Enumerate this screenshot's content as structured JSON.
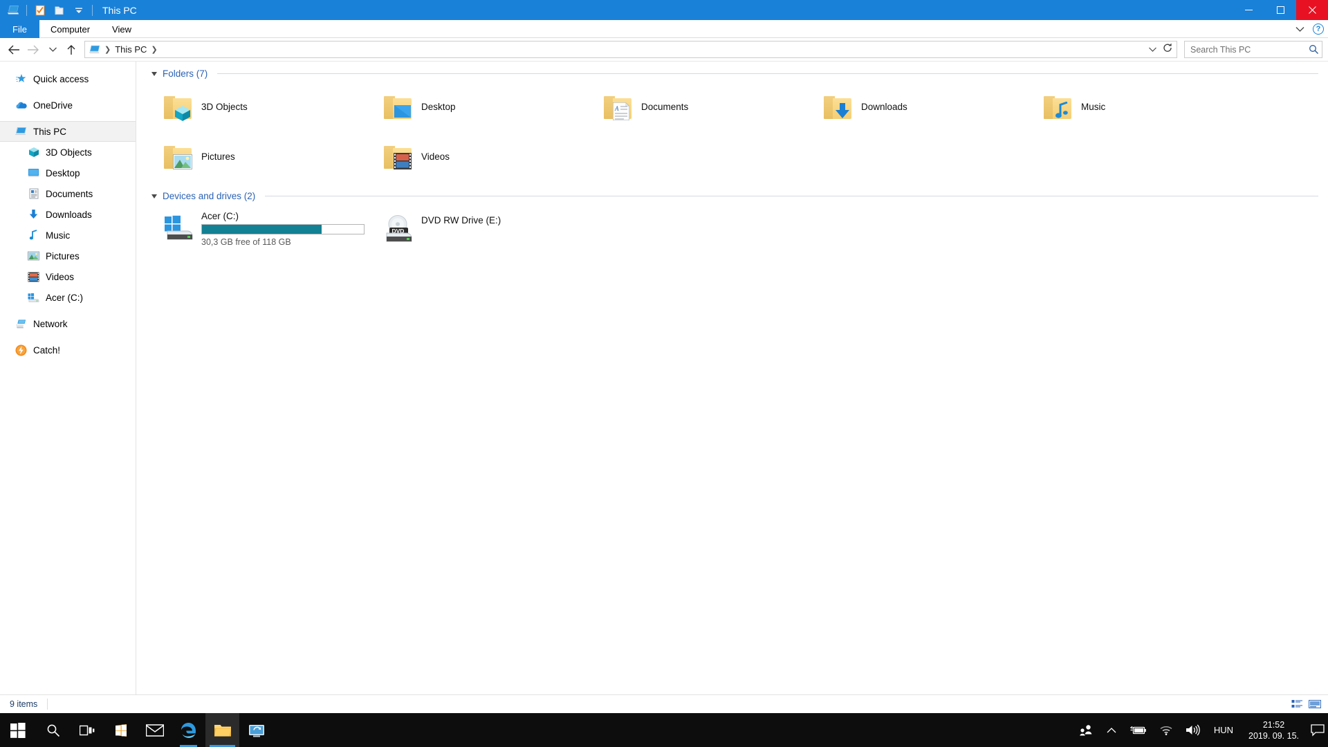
{
  "window": {
    "title": "This PC",
    "quick_access_icons": [
      "this-pc-icon",
      "properties-icon",
      "new-folder-icon",
      "customize-dropdown-icon"
    ],
    "controls": {
      "minimize": "minimize",
      "maximize": "maximize",
      "close": "close"
    }
  },
  "ribbon": {
    "tabs": [
      {
        "label": "File",
        "active_file": true
      },
      {
        "label": "Computer",
        "active_file": false
      },
      {
        "label": "View",
        "active_file": false
      }
    ],
    "collapse_label": "expand-ribbon-icon",
    "help_label": "?"
  },
  "address": {
    "back": "back-arrow-icon",
    "forward": "forward-arrow-icon",
    "recent": "recent-locations-icon",
    "up": "up-arrow-icon",
    "breadcrumb": [
      "This PC"
    ],
    "dropdown": "address-dropdown-icon",
    "refresh": "refresh-icon"
  },
  "search": {
    "placeholder": "Search This PC",
    "value": "",
    "icon": "search-icon"
  },
  "sidebar": {
    "items": [
      {
        "label": "Quick access",
        "icon": "star-icon",
        "indent": false,
        "selected": false,
        "gap_after": true
      },
      {
        "label": "OneDrive",
        "icon": "cloud-icon",
        "indent": false,
        "selected": false,
        "gap_after": true
      },
      {
        "label": "This PC",
        "icon": "pc-icon",
        "indent": false,
        "selected": true,
        "gap_after": false
      },
      {
        "label": "3D Objects",
        "icon": "cube-icon",
        "indent": true,
        "selected": false,
        "gap_after": false
      },
      {
        "label": "Desktop",
        "icon": "desktop-icon",
        "indent": true,
        "selected": false,
        "gap_after": false
      },
      {
        "label": "Documents",
        "icon": "documents-icon",
        "indent": true,
        "selected": false,
        "gap_after": false
      },
      {
        "label": "Downloads",
        "icon": "downloads-icon",
        "indent": true,
        "selected": false,
        "gap_after": false
      },
      {
        "label": "Music",
        "icon": "music-icon",
        "indent": true,
        "selected": false,
        "gap_after": false
      },
      {
        "label": "Pictures",
        "icon": "pictures-icon",
        "indent": true,
        "selected": false,
        "gap_after": false
      },
      {
        "label": "Videos",
        "icon": "videos-icon",
        "indent": true,
        "selected": false,
        "gap_after": false
      },
      {
        "label": "Acer (C:)",
        "icon": "drive-icon",
        "indent": true,
        "selected": false,
        "gap_after": true
      },
      {
        "label": "Network",
        "icon": "network-icon",
        "indent": false,
        "selected": false,
        "gap_after": true
      },
      {
        "label": "Catch!",
        "icon": "catch-icon",
        "indent": false,
        "selected": false,
        "gap_after": false
      }
    ]
  },
  "content": {
    "groups": [
      {
        "title": "Folders (7)",
        "items": [
          {
            "label": "3D Objects",
            "icon": "folder-3d-objects-icon"
          },
          {
            "label": "Desktop",
            "icon": "folder-desktop-icon"
          },
          {
            "label": "Documents",
            "icon": "folder-documents-icon"
          },
          {
            "label": "Downloads",
            "icon": "folder-downloads-icon"
          },
          {
            "label": "Music",
            "icon": "folder-music-icon"
          },
          {
            "label": "Pictures",
            "icon": "folder-pictures-icon"
          },
          {
            "label": "Videos",
            "icon": "folder-videos-icon"
          }
        ]
      },
      {
        "title": "Devices and drives (2)",
        "drives": [
          {
            "label": "Acer (C:)",
            "icon": "windows-drive-icon",
            "free_text": "30,3 GB free of 118 GB",
            "used_percent": 74,
            "bar_color": "#128193",
            "has_bar": true
          },
          {
            "label": "DVD RW Drive (E:)",
            "icon": "dvd-drive-icon",
            "free_text": "",
            "used_percent": 0,
            "bar_color": "",
            "has_bar": false
          }
        ]
      }
    ]
  },
  "statusbar": {
    "items_text": "9 items",
    "view_details": "details-view-icon",
    "view_large": "large-icons-view-icon"
  },
  "taskbar": {
    "start": "windows-start-icon",
    "search": "search-icon",
    "task_view": "task-view-icon",
    "apps": [
      {
        "name": "microsoft-store-icon",
        "active": false
      },
      {
        "name": "mail-icon",
        "active": false
      },
      {
        "name": "edge-icon",
        "active": false
      },
      {
        "name": "file-explorer-icon",
        "active": true
      },
      {
        "name": "app-icon",
        "active": false
      }
    ],
    "tray": {
      "people": "people-icon",
      "chevron": "show-hidden-icons-icon",
      "battery": "battery-charging-icon",
      "wifi": "wifi-icon",
      "volume": "volume-icon",
      "language": "HUN",
      "time": "21:52",
      "date": "2019. 09. 15.",
      "action_center": "action-center-icon"
    }
  },
  "colors": {
    "accent": "#1a81d8",
    "close": "#e81123",
    "group_title": "#2a62b5",
    "drive_bar": "#128193",
    "taskbar": "#0d0d0d"
  }
}
